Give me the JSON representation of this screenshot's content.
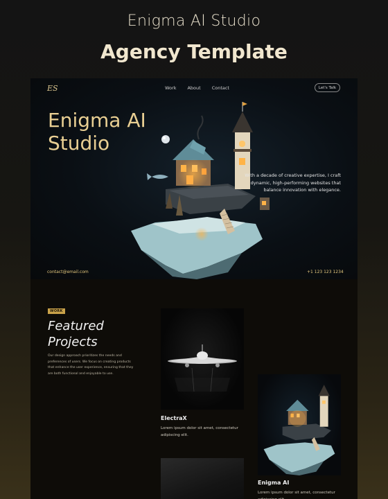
{
  "header": {
    "title": "Enigma AI Studio",
    "subtitle": "Agency Template"
  },
  "nav": {
    "logo": "ES",
    "links": [
      "Work",
      "About",
      "Contact"
    ],
    "cta": "Let's Talk"
  },
  "hero": {
    "title": "Enigma AI Studio",
    "description": "With a decade of creative expertise, I craft dynamic, high-performing websites that balance innovation with elegance.",
    "email": "contact@email.com",
    "phone": "+1 123 123 1234"
  },
  "works": {
    "badge": "WORK",
    "heading": "Featured Projects",
    "description": "Our design approach prioritizes the needs and preferences of users. We focus on creating products that enhance the user experience, ensuring that they are both functional and enjoyable to use.",
    "projects": [
      {
        "title": "ElectraX",
        "description": "Lorem ipsum dolor sit amet, consectetur adipiscing elit."
      },
      {
        "title": "Enigma AI",
        "description": "Lorem ipsum dolor sit amet, consectetur adipiscing elit."
      }
    ]
  },
  "colors": {
    "accent": "#e9cf93",
    "badge": "#c9a24a",
    "background": "#0e0c08"
  }
}
